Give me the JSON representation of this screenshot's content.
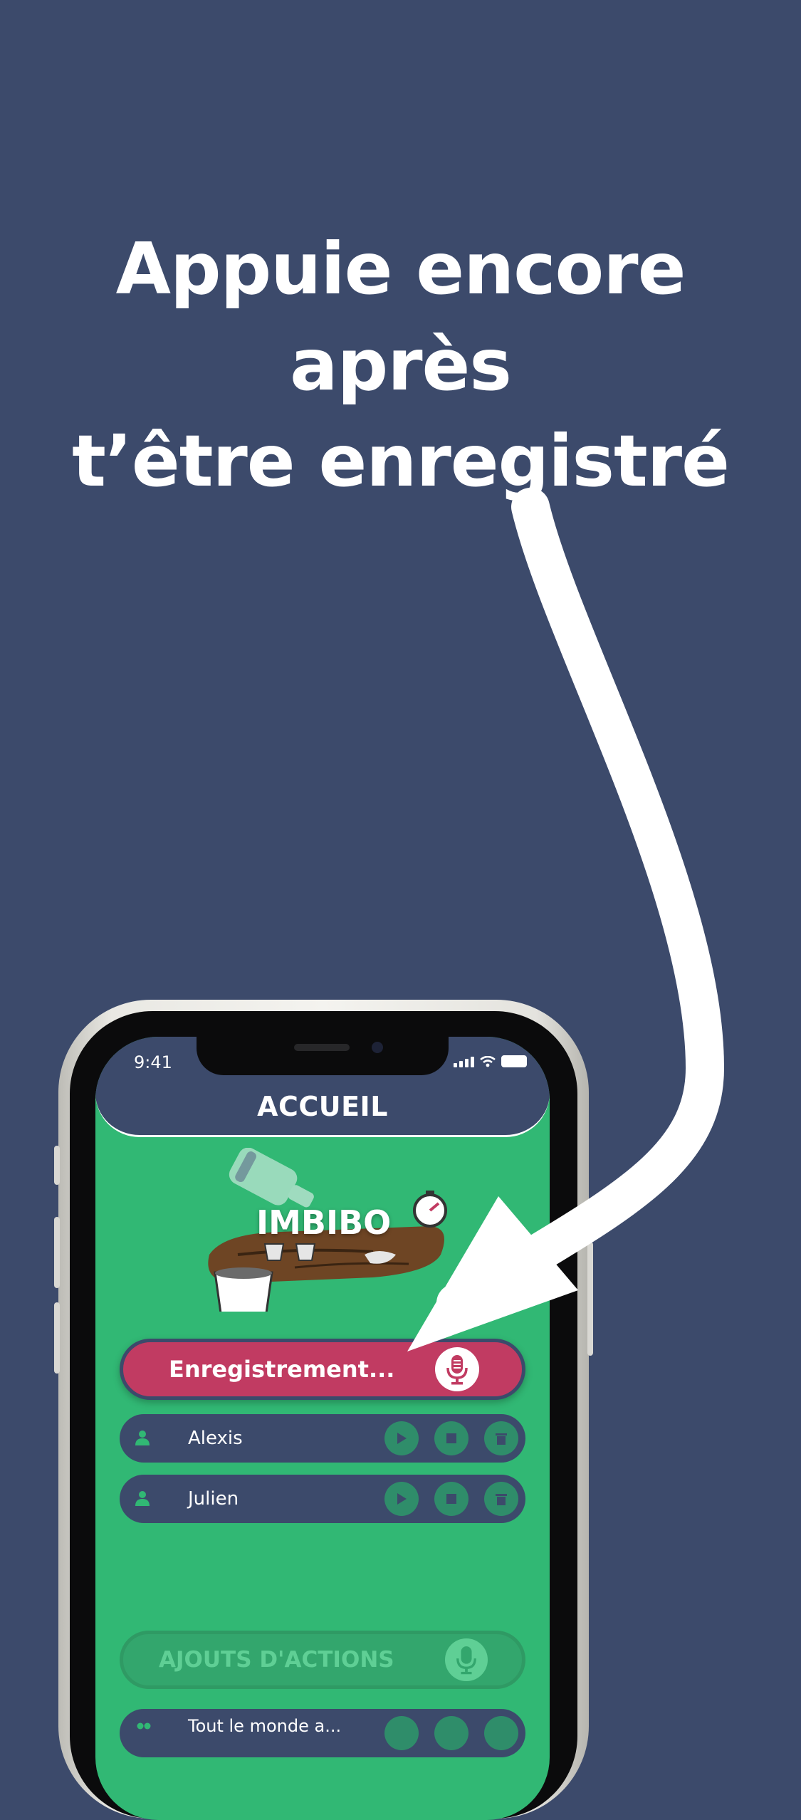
{
  "headline": {
    "line1": "Appuie encore après",
    "line2": "t’être enregistré"
  },
  "status_bar": {
    "time": "9:41"
  },
  "header": {
    "title": "ACCUEIL"
  },
  "logo": {
    "text": "IMBIBO"
  },
  "record_button": {
    "label": "Enregistrement..."
  },
  "players": [
    {
      "name": "Alexis"
    },
    {
      "name": "Julien"
    }
  ],
  "actions_button": {
    "label": "AJOUTS D'ACTIONS"
  },
  "actions": [
    {
      "label": "Tout le monde a..."
    }
  ],
  "colors": {
    "background": "#3c4a6b",
    "screen_green": "#31b874",
    "record_red": "#c13b62",
    "white": "#ffffff"
  }
}
